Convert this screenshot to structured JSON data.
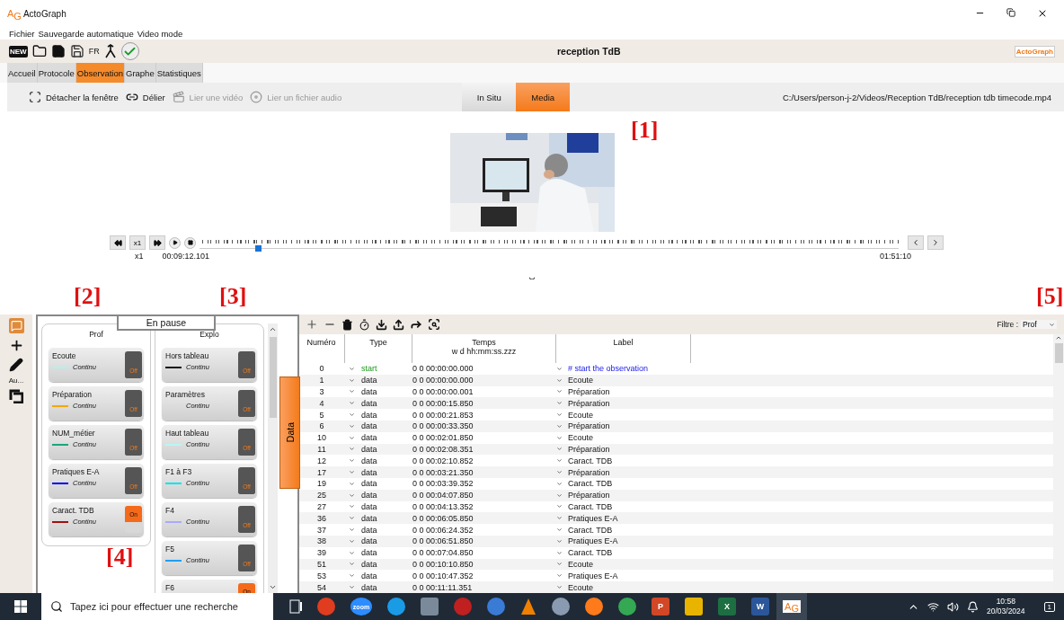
{
  "app": {
    "logo_letters": [
      "A",
      "G"
    ],
    "title": "ActoGraph"
  },
  "menu": [
    "Fichier",
    "Sauvegarde automatique",
    "Video mode"
  ],
  "toolbar": {
    "new_label": "NEW",
    "language": "FR",
    "document_title": "reception TdB",
    "logo_text": "ActoGraph"
  },
  "tabs": [
    {
      "label": "Accueil",
      "selected": false
    },
    {
      "label": "Protocole",
      "selected": false
    },
    {
      "label": "Observation",
      "selected": true
    },
    {
      "label": "Graphe",
      "selected": false
    },
    {
      "label": "Statistiques",
      "selected": false
    }
  ],
  "actions": [
    {
      "kind": "detach",
      "label": "Détacher la fenêtre",
      "disabled": false
    },
    {
      "kind": "unlink",
      "label": "Délier",
      "disabled": false
    },
    {
      "kind": "video",
      "label": "Lier une vidéo",
      "disabled": true
    },
    {
      "kind": "audio",
      "label": "Lier un fichier audio",
      "disabled": true
    }
  ],
  "mode_toggle": [
    {
      "label": "In Situ",
      "selected": false
    },
    {
      "label": "Media",
      "selected": true
    }
  ],
  "file_path": "C:/Users/person-j-2/Videos/Reception TdB/reception tdb timecode.mp4",
  "player": {
    "speed_button": "x1",
    "speed": "x1",
    "current_time": "00:09:12.101",
    "duration": "01:51:10",
    "level": 0.08
  },
  "annotations": [
    "[1]",
    "[2]",
    "[3]",
    "[4]",
    "[5]"
  ],
  "side_tools": {
    "auto_label": "Au..."
  },
  "status": "En pause",
  "columns": [
    {
      "title": "Prof",
      "behaviours": [
        {
          "name": "Ecoute",
          "color": "#aef3f0",
          "style": "Continu",
          "on": false,
          "switch_label": "Off"
        },
        {
          "name": "Préparation",
          "color": "#f5a800",
          "style": "Continu",
          "on": false,
          "switch_label": "Off"
        },
        {
          "name": "NUM_métier",
          "color": "#1aa67a",
          "style": "Continu",
          "on": false,
          "switch_label": "Off"
        },
        {
          "name": "Pratiques E-A",
          "color": "#0000ee",
          "style": "Continu",
          "on": false,
          "switch_label": "Off"
        },
        {
          "name": "Caract. TDB",
          "color": "#a01010",
          "style": "Continu",
          "on": true,
          "switch_label": "On"
        }
      ]
    },
    {
      "title": "Explo",
      "behaviours": [
        {
          "name": "Hors tableau",
          "color": "#111111",
          "style": "Continu",
          "on": false,
          "switch_label": "Off"
        },
        {
          "name": "Paramètres",
          "style": "Continu",
          "on": false,
          "switch_label": "Off"
        },
        {
          "name": "Haut tableau",
          "color": "#b8f5f5",
          "style": "Continu",
          "on": false,
          "switch_label": "Off"
        },
        {
          "name": "F1 à F3",
          "color": "#00e5ee",
          "style": "Continu",
          "on": false,
          "switch_label": "Off"
        },
        {
          "name": "F4",
          "color": "#aaaaff",
          "style": "Continu",
          "on": false,
          "switch_label": "Off"
        },
        {
          "name": "F5",
          "color": "#1e9ff0",
          "style": "Continu",
          "on": false,
          "switch_label": "Off"
        },
        {
          "name": "F6",
          "on": true,
          "switch_label": "On"
        }
      ]
    }
  ],
  "data_tab": "Data",
  "filter": {
    "label": "Filtre :",
    "value": "Prof"
  },
  "table": {
    "columns": [
      "Numéro",
      "Type",
      "Temps",
      "Label"
    ],
    "temps_format": "w d hh:mm:ss.zzz",
    "rows": [
      {
        "numero": "0",
        "kind": "start",
        "type": "start",
        "temps": "0 0 00:00:00.000",
        "label": "# start the observation"
      },
      {
        "numero": "1",
        "kind": "data",
        "type": "data",
        "temps": "0 0 00:00:00.000",
        "label": "Ecoute"
      },
      {
        "numero": "3",
        "kind": "data",
        "type": "data",
        "temps": "0 0 00:00:00.001",
        "label": "Préparation"
      },
      {
        "numero": "4",
        "kind": "data",
        "type": "data",
        "temps": "0 0 00:00:15.850",
        "label": "Préparation"
      },
      {
        "numero": "5",
        "kind": "data",
        "type": "data",
        "temps": "0 0 00:00:21.853",
        "label": "Ecoute"
      },
      {
        "numero": "6",
        "kind": "data",
        "type": "data",
        "temps": "0 0 00:00:33.350",
        "label": "Préparation"
      },
      {
        "numero": "10",
        "kind": "data",
        "type": "data",
        "temps": "0 0 00:02:01.850",
        "label": "Ecoute"
      },
      {
        "numero": "11",
        "kind": "data",
        "type": "data",
        "temps": "0 0 00:02:08.351",
        "label": "Préparation"
      },
      {
        "numero": "12",
        "kind": "data",
        "type": "data",
        "temps": "0 0 00:02:10.852",
        "label": "Caract. TDB"
      },
      {
        "numero": "17",
        "kind": "data",
        "type": "data",
        "temps": "0 0 00:03:21.350",
        "label": "Préparation"
      },
      {
        "numero": "19",
        "kind": "data",
        "type": "data",
        "temps": "0 0 00:03:39.352",
        "label": "Caract. TDB"
      },
      {
        "numero": "25",
        "kind": "data",
        "type": "data",
        "temps": "0 0 00:04:07.850",
        "label": "Préparation"
      },
      {
        "numero": "27",
        "kind": "data",
        "type": "data",
        "temps": "0 0 00:04:13.352",
        "label": "Caract. TDB"
      },
      {
        "numero": "36",
        "kind": "data",
        "type": "data",
        "temps": "0 0 00:06:05.850",
        "label": "Pratiques E-A"
      },
      {
        "numero": "37",
        "kind": "data",
        "type": "data",
        "temps": "0 0 00:06:24.352",
        "label": "Caract. TDB"
      },
      {
        "numero": "38",
        "kind": "data",
        "type": "data",
        "temps": "0 0 00:06:51.850",
        "label": "Pratiques E-A"
      },
      {
        "numero": "39",
        "kind": "data",
        "type": "data",
        "temps": "0 0 00:07:04.850",
        "label": "Caract. TDB"
      },
      {
        "numero": "51",
        "kind": "data",
        "type": "data",
        "temps": "0 0 00:10:10.850",
        "label": "Ecoute"
      },
      {
        "numero": "53",
        "kind": "data",
        "type": "data",
        "temps": "0 0 00:10:47.352",
        "label": "Pratiques E-A"
      },
      {
        "numero": "54",
        "kind": "data",
        "type": "data",
        "temps": "0 0 00:11:11.351",
        "label": "Ecoute"
      }
    ]
  },
  "taskbar": {
    "search_placeholder": "Tapez ici pour effectuer une recherche",
    "pinned": [
      {
        "kind": "round",
        "color": "#e03c20"
      },
      {
        "kind": "round",
        "color": "#2d8cff",
        "glyph": "zoom"
      },
      {
        "kind": "round",
        "color": "#1a9be6"
      },
      {
        "kind": "square",
        "color": "#7a8a9a"
      },
      {
        "kind": "round",
        "color": "#c02020"
      },
      {
        "kind": "round",
        "color": "#3a7bd5"
      },
      {
        "kind": "cone",
        "color": "#f08000"
      },
      {
        "kind": "round",
        "color": "#8a9ab0"
      },
      {
        "kind": "round",
        "color": "#ff7a1a"
      },
      {
        "kind": "round",
        "color": "#34a853"
      },
      {
        "kind": "square",
        "color": "#d24726",
        "glyph": "P"
      },
      {
        "kind": "square",
        "color": "#e8b400"
      },
      {
        "kind": "square",
        "color": "#1d6f42",
        "glyph": "X"
      },
      {
        "kind": "square",
        "color": "#2b579a",
        "glyph": "W"
      }
    ],
    "app_badge": [
      "A",
      "G"
    ],
    "time": "10:58",
    "date": "20/03/2024",
    "notifications": "1"
  }
}
